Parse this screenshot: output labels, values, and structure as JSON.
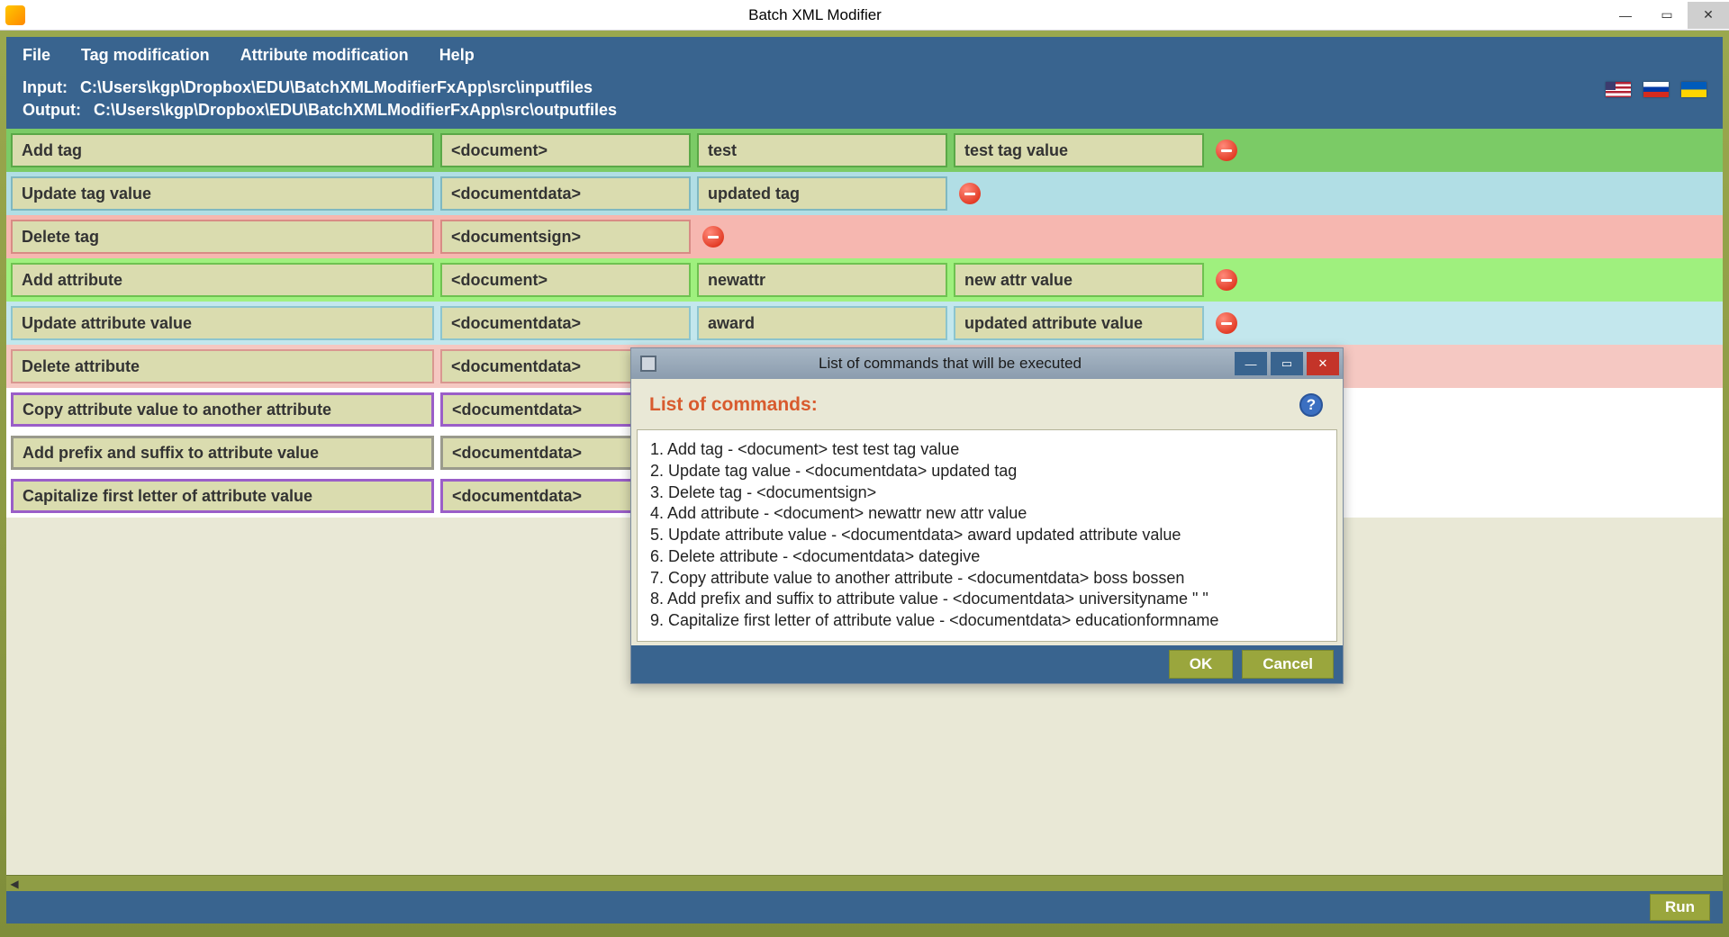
{
  "window": {
    "title": "Batch XML Modifier"
  },
  "menu": {
    "file": "File",
    "tag_mod": "Tag modification",
    "attr_mod": "Attribute modification",
    "help": "Help"
  },
  "paths": {
    "input_label": "Input:",
    "input_path": "C:\\Users\\kgp\\Dropbox\\EDU\\BatchXMLModifierFxApp\\src\\inputfiles",
    "output_label": "Output:",
    "output_path": "C:\\Users\\kgp\\Dropbox\\EDU\\BatchXMLModifierFxApp\\src\\outputfiles"
  },
  "rows": [
    {
      "style": "row-green",
      "action": "Add tag",
      "tag": "<document>",
      "v1": "test",
      "v2": "test tag value",
      "cols": 4
    },
    {
      "style": "row-blue",
      "action": "Update tag value",
      "tag": "<documentdata>",
      "v1": "updated tag",
      "cols": 3
    },
    {
      "style": "row-red",
      "action": "Delete tag",
      "tag": "<documentsign>",
      "cols": 2
    },
    {
      "style": "row-lgreen",
      "action": "Add attribute",
      "tag": "<document>",
      "v1": "newattr",
      "v2": "new attr value",
      "cols": 4
    },
    {
      "style": "row-cyan",
      "action": "Update attribute value",
      "tag": "<documentdata>",
      "v1": "award",
      "v2": "updated attribute value",
      "cols": 4
    },
    {
      "style": "row-pink",
      "action": "Delete attribute",
      "tag": "<documentdata>",
      "cols": 2
    },
    {
      "style": "row-purple",
      "action": "Copy attribute value to another attribute",
      "tag": "<documentdata>",
      "cols": 2
    },
    {
      "style": "row-gray",
      "action": "Add prefix and suffix to attribute value",
      "tag": "<documentdata>",
      "cols": 2
    },
    {
      "style": "row-purple",
      "action": "Capitalize first letter of attribute value",
      "tag": "<documentdata>",
      "cols": 2
    }
  ],
  "run_label": "Run",
  "dialog": {
    "title": "List of commands that will be executed",
    "header": "List of commands:",
    "items": [
      "1. Add tag - <document>  test  test tag value",
      "2. Update tag value - <documentdata>  updated tag",
      "3. Delete tag - <documentsign>",
      "4. Add attribute - <document>  newattr  new attr value",
      "5. Update attribute value - <documentdata>  award  updated attribute value",
      "6. Delete attribute - <documentdata>  dategive",
      "7. Copy attribute value to another attribute - <documentdata>  boss  bossen",
      "8. Add prefix and suffix to attribute value - <documentdata>  universityname  \"  \"",
      "9. Capitalize first letter of attribute value - <documentdata>  educationformname"
    ],
    "ok": "OK",
    "cancel": "Cancel",
    "help_symbol": "?"
  }
}
